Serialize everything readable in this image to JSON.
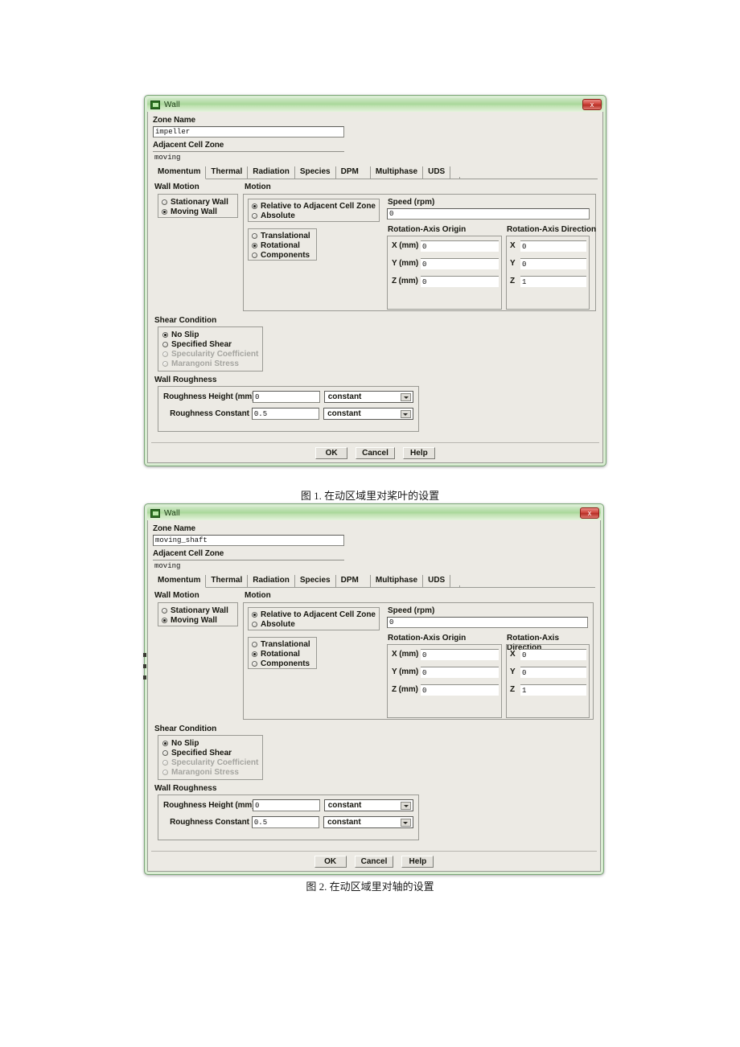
{
  "page": {
    "background": "#ffffff",
    "captions": [
      {
        "text": "图 1. 在动区域里对桨叶的设置"
      },
      {
        "text": "图 2. 在动区域里对轴的设置"
      }
    ]
  },
  "colors": {
    "titlebar_green": "#a9d79a",
    "dialog_face": "#eceae4",
    "close_red": "#d0453c",
    "frame_green": "#7ba678"
  },
  "dialogs": [
    {
      "title": "Wall",
      "window_icon": "fluent-app-icon",
      "close_label": "x",
      "zone_name_label": "Zone Name",
      "zone_name_value": "impeller",
      "adjacent_cell_zone_label": "Adjacent Cell Zone",
      "adjacent_cell_zone_value": "moving",
      "tabs": [
        {
          "label": "Momentum",
          "active": true
        },
        {
          "label": "Thermal",
          "active": false
        },
        {
          "label": "Radiation",
          "active": false
        },
        {
          "label": "Species",
          "active": false
        },
        {
          "label": "DPM",
          "active": false
        },
        {
          "label": "Multiphase",
          "active": false
        },
        {
          "label": "UDS",
          "active": false
        }
      ],
      "wall_motion": {
        "title": "Wall Motion",
        "options": [
          {
            "label": "Stationary Wall",
            "selected": false
          },
          {
            "label": "Moving Wall",
            "selected": true
          }
        ]
      },
      "motion": {
        "title": "Motion",
        "reference_options": [
          {
            "label": "Relative to Adjacent Cell Zone",
            "selected": true
          },
          {
            "label": "Absolute",
            "selected": false
          }
        ],
        "type_options": [
          {
            "label": "Translational",
            "selected": false
          },
          {
            "label": "Rotational",
            "selected": true
          },
          {
            "label": "Components",
            "selected": false
          }
        ],
        "speed_label": "Speed (rpm)",
        "speed_value": "0",
        "origin_title": "Rotation-Axis Origin",
        "origin": [
          {
            "label": "X (mm)",
            "value": "0"
          },
          {
            "label": "Y (mm)",
            "value": "0"
          },
          {
            "label": "Z (mm)",
            "value": "0"
          }
        ],
        "direction_title": "Rotation-Axis Direction",
        "direction": [
          {
            "label": "X",
            "value": "0"
          },
          {
            "label": "Y",
            "value": "0"
          },
          {
            "label": "Z",
            "value": "1"
          }
        ]
      },
      "shear_condition": {
        "title": "Shear Condition",
        "options": [
          {
            "label": "No Slip",
            "selected": true,
            "disabled": false
          },
          {
            "label": "Specified Shear",
            "selected": false,
            "disabled": false
          },
          {
            "label": "Specularity Coefficient",
            "selected": false,
            "disabled": true
          },
          {
            "label": "Marangoni Stress",
            "selected": false,
            "disabled": true
          }
        ]
      },
      "wall_roughness": {
        "title": "Wall Roughness",
        "rows": [
          {
            "label": "Roughness Height (mm)",
            "value": "0",
            "method": "constant"
          },
          {
            "label": "Roughness Constant",
            "value": "0.5",
            "method": "constant"
          }
        ]
      },
      "buttons": [
        {
          "label": "OK"
        },
        {
          "label": "Cancel"
        },
        {
          "label": "Help"
        }
      ]
    },
    {
      "title": "Wall",
      "window_icon": "fluent-app-icon",
      "close_label": "x",
      "zone_name_label": "Zone Name",
      "zone_name_value": "moving_shaft",
      "adjacent_cell_zone_label": "Adjacent Cell Zone",
      "adjacent_cell_zone_value": "moving",
      "tabs": [
        {
          "label": "Momentum",
          "active": true
        },
        {
          "label": "Thermal",
          "active": false
        },
        {
          "label": "Radiation",
          "active": false
        },
        {
          "label": "Species",
          "active": false
        },
        {
          "label": "DPM",
          "active": false
        },
        {
          "label": "Multiphase",
          "active": false
        },
        {
          "label": "UDS",
          "active": false
        }
      ],
      "wall_motion": {
        "title": "Wall Motion",
        "options": [
          {
            "label": "Stationary Wall",
            "selected": false
          },
          {
            "label": "Moving Wall",
            "selected": true
          }
        ]
      },
      "motion": {
        "title": "Motion",
        "reference_options": [
          {
            "label": "Relative to Adjacent Cell Zone",
            "selected": true
          },
          {
            "label": "Absolute",
            "selected": false
          }
        ],
        "type_options": [
          {
            "label": "Translational",
            "selected": false
          },
          {
            "label": "Rotational",
            "selected": true
          },
          {
            "label": "Components",
            "selected": false
          }
        ],
        "speed_label": "Speed (rpm)",
        "speed_value": "0",
        "origin_title": "Rotation-Axis Origin",
        "origin": [
          {
            "label": "X (mm)",
            "value": "0"
          },
          {
            "label": "Y (mm)",
            "value": "0"
          },
          {
            "label": "Z (mm)",
            "value": "0"
          }
        ],
        "direction_title": "Rotation-Axis Direction",
        "direction": [
          {
            "label": "X",
            "value": "0"
          },
          {
            "label": "Y",
            "value": "0"
          },
          {
            "label": "Z",
            "value": "1"
          }
        ]
      },
      "shear_condition": {
        "title": "Shear Condition",
        "options": [
          {
            "label": "No Slip",
            "selected": true,
            "disabled": false
          },
          {
            "label": "Specified Shear",
            "selected": false,
            "disabled": false
          },
          {
            "label": "Specularity Coefficient",
            "selected": false,
            "disabled": true
          },
          {
            "label": "Marangoni Stress",
            "selected": false,
            "disabled": true
          }
        ]
      },
      "wall_roughness": {
        "title": "Wall Roughness",
        "rows": [
          {
            "label": "Roughness Height (mm)",
            "value": "0",
            "method": "constant"
          },
          {
            "label": "Roughness Constant",
            "value": "0.5",
            "method": "constant"
          }
        ]
      },
      "buttons": [
        {
          "label": "OK"
        },
        {
          "label": "Cancel"
        },
        {
          "label": "Help"
        }
      ]
    }
  ]
}
